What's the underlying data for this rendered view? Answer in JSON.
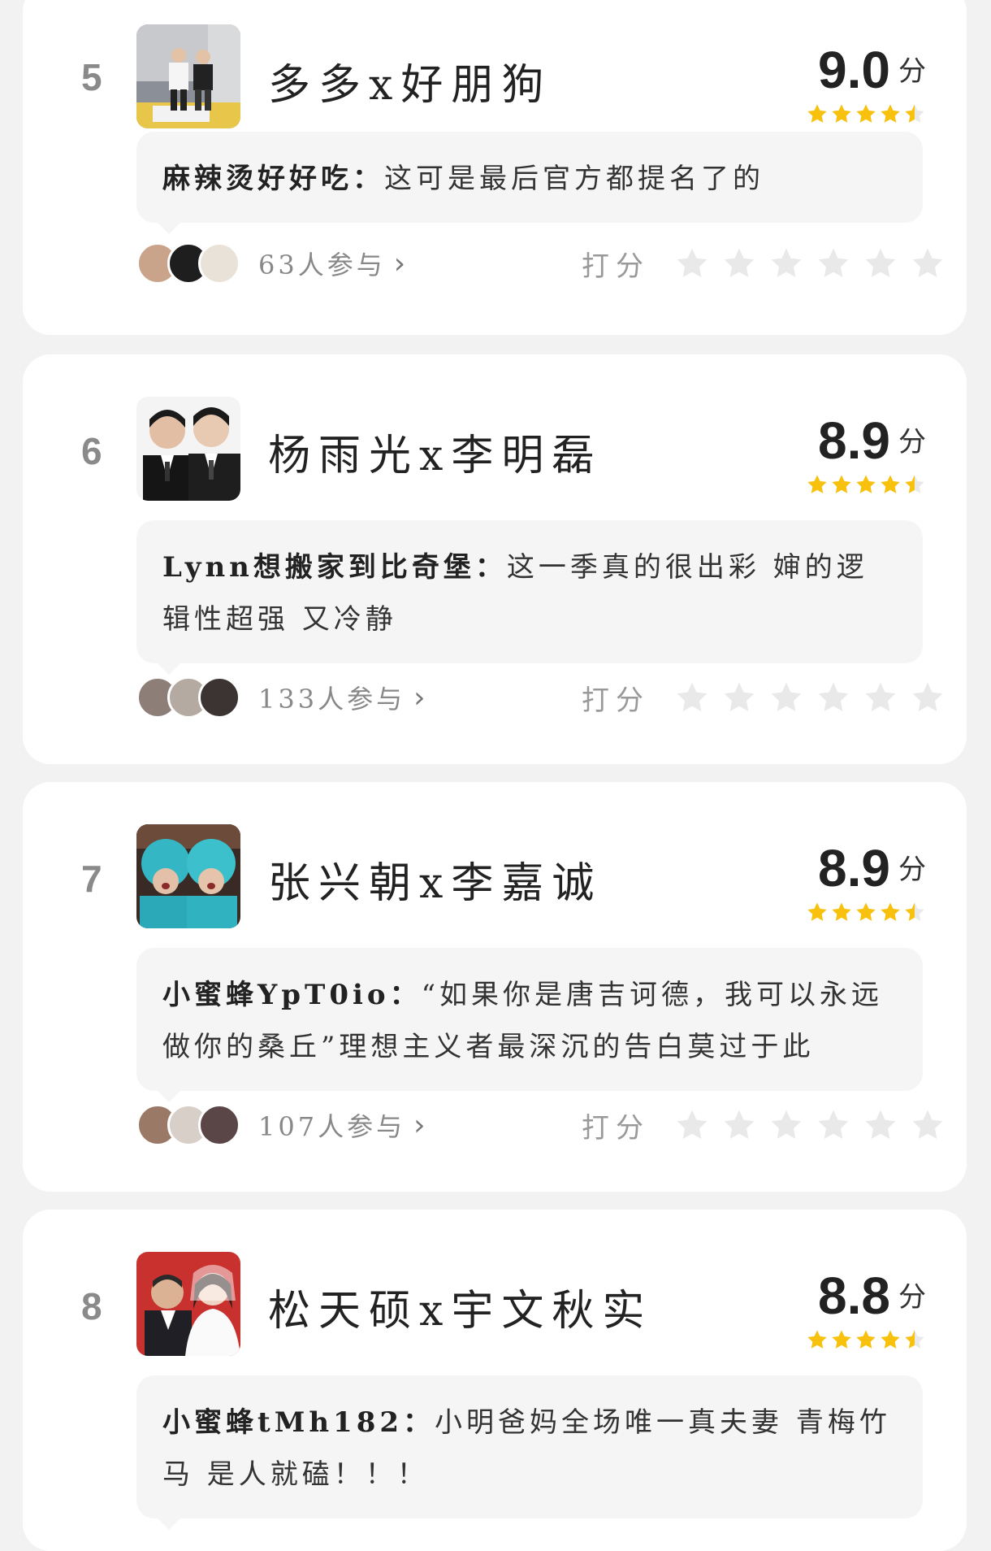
{
  "score_unit": "分",
  "rate_label": "打分",
  "colors": {
    "star_gold": "#f8c10e",
    "star_empty": "#e9e9e9"
  },
  "items": [
    {
      "rank": "5",
      "title": "多多x好朋狗",
      "score": "9.0",
      "stars": 4.5,
      "comment_user": "麻辣烫好好吃：",
      "comment_text": "这可是最后官方都提名了的",
      "participants": "63人参与"
    },
    {
      "rank": "6",
      "title": "杨雨光x李明磊",
      "score": "8.9",
      "stars": 4.5,
      "comment_user": "Lynn想搬家到比奇堡：",
      "comment_text": "这一季真的很出彩 婶的逻辑性超强 又冷静",
      "participants": "133人参与"
    },
    {
      "rank": "7",
      "title": "张兴朝x李嘉诚",
      "score": "8.9",
      "stars": 4.5,
      "comment_user": "小蜜蜂YpT0io：",
      "comment_text": "“如果你是唐吉诃德，我可以永远做你的桑丘”理想主义者最深沉的告白莫过于此",
      "participants": "107人参与"
    },
    {
      "rank": "8",
      "title": "松天硕x宇文秋实",
      "score": "8.8",
      "stars": 4.5,
      "comment_user": "小蜜蜂tMh182：",
      "comment_text": "小明爸妈全场唯一真夫妻 青梅竹马 是人就磕！！！"
    }
  ]
}
